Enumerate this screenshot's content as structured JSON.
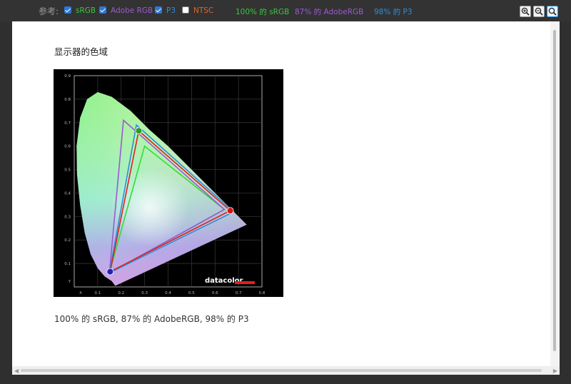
{
  "toolbar": {
    "reference_label": "参考:",
    "options": [
      {
        "label": "sRGB",
        "checked": true,
        "color": "#3cc43c"
      },
      {
        "label": "Adobe RGB",
        "checked": true,
        "color": "#9b59d0"
      },
      {
        "label": "P3",
        "checked": true,
        "color": "#2d8ed8"
      },
      {
        "label": "NTSC",
        "checked": false,
        "color": "#e0632c"
      }
    ],
    "stats": [
      {
        "text": "100% 的 sRGB",
        "color": "#3cc43c"
      },
      {
        "text": "87% 的 AdobeRGB",
        "color": "#9b59d0"
      },
      {
        "text": "98% 的 P3",
        "color": "#2d8ed8"
      }
    ],
    "zoom": [
      "zoom-in-icon",
      "zoom-out-icon",
      "zoom-fit-icon"
    ]
  },
  "page": {
    "title": "显示器的色域",
    "summary": "100% 的 sRGB, 87% 的 AdobeRGB, 98% 的 P3"
  },
  "chart_data": {
    "type": "scatter",
    "brand": "datacolor",
    "x_ticks": [
      "X",
      "0.1",
      "0.2",
      "0.3",
      "0.4",
      "0.5",
      "0.6",
      "0.7",
      "0.8"
    ],
    "y_ticks": [
      "Y",
      "0.1",
      "0.2",
      "0.3",
      "0.4",
      "0.5",
      "0.6",
      "0.7",
      "0.8",
      "0.9"
    ],
    "xlim": [
      0,
      0.8
    ],
    "ylim": [
      0,
      0.9
    ],
    "gamuts": [
      {
        "name": "sRGB",
        "color": "#33dd33",
        "points": [
          [
            0.64,
            0.33
          ],
          [
            0.3,
            0.6
          ],
          [
            0.15,
            0.06
          ]
        ]
      },
      {
        "name": "Adobe RGB",
        "color": "#9b59d0",
        "points": [
          [
            0.64,
            0.33
          ],
          [
            0.21,
            0.71
          ],
          [
            0.15,
            0.06
          ]
        ]
      },
      {
        "name": "P3",
        "color": "#2d8ed8",
        "points": [
          [
            0.68,
            0.32
          ],
          [
            0.265,
            0.69
          ],
          [
            0.15,
            0.06
          ]
        ]
      },
      {
        "name": "Display",
        "color": "#e02020",
        "points": [
          [
            0.665,
            0.325
          ],
          [
            0.275,
            0.665
          ],
          [
            0.153,
            0.065
          ]
        ]
      }
    ],
    "measured_points": [
      {
        "label": "red",
        "color": "#d01818",
        "x": 0.665,
        "y": 0.325
      },
      {
        "label": "green",
        "color": "#2a9a2a",
        "x": 0.275,
        "y": 0.665
      },
      {
        "label": "blue",
        "color": "#2020c0",
        "x": 0.153,
        "y": 0.065
      }
    ]
  }
}
